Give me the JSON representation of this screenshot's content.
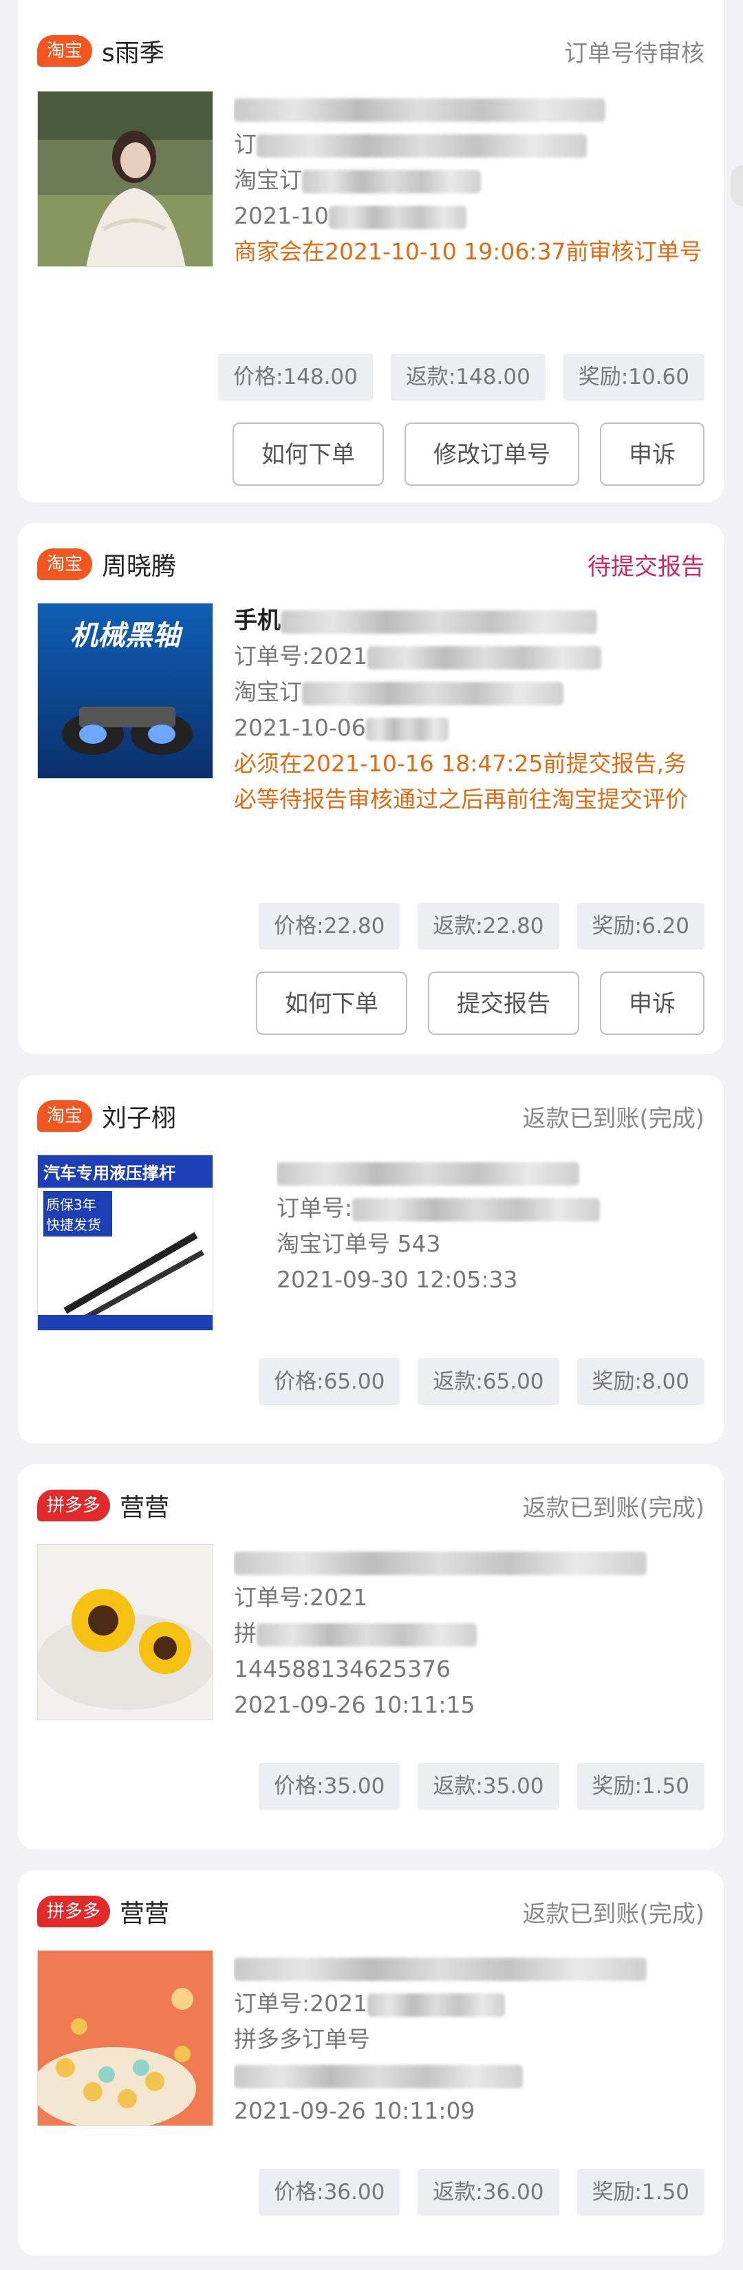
{
  "orders": [
    {
      "platform": "淘宝",
      "buyer": "s雨季",
      "status": "订单号待审核",
      "lines": [
        "订",
        "淘宝订",
        "2021-10"
      ],
      "warning": "商家会在2021-10-10 19:06:37前审核订单号",
      "price": "价格:148.00",
      "refund": "返款:148.00",
      "reward": "奖励:10.60",
      "actions": [
        "如何下单",
        "修改订单号",
        "申诉"
      ]
    },
    {
      "platform": "淘宝",
      "buyer": "周晓腾",
      "status": "待提交报告",
      "title": "手机",
      "lines": [
        "订单号:2021",
        "淘宝订",
        "2021-10-06"
      ],
      "warning": "必须在2021-10-16 18:47:25前提交报告,务必等待报告审核通过之后再前往淘宝提交评价",
      "price": "价格:22.80",
      "refund": "返款:22.80",
      "reward": "奖励:6.20",
      "actions": [
        "如何下单",
        "提交报告",
        "申诉"
      ],
      "thumb_text": "机械黑轴"
    },
    {
      "platform": "淘宝",
      "buyer": "刘子栩",
      "status": "返款已到账(完成)",
      "lines": [
        "订单号:",
        "淘宝订单号 543",
        "2021-09-30 12:05:33"
      ],
      "price": "价格:65.00",
      "refund": "返款:65.00",
      "reward": "奖励:8.00",
      "thumb_title": "汽车专用液压撑杆",
      "thumb_badge": "质保3年 快捷发货"
    },
    {
      "platform": "拼多多",
      "buyer": "营营",
      "status": "返款已到账(完成)",
      "lines": [
        "订单号:2021",
        "拼",
        "144588134625376",
        "2021-09-26 10:11:15"
      ],
      "price": "价格:35.00",
      "refund": "返款:35.00",
      "reward": "奖励:1.50"
    },
    {
      "platform": "拼多多",
      "buyer": "营营",
      "status": "返款已到账(完成)",
      "lines": [
        "订单号:2021",
        "拼多多订单号",
        "2021-09-26 10:11:09"
      ],
      "price": "价格:36.00",
      "refund": "返款:36.00",
      "reward": "奖励:1.50"
    }
  ],
  "colors": {
    "taobao_tag": "#f3561f",
    "pdd_tag": "#e12a2a",
    "warning_text": "#e06b12",
    "pending_status": "#d02763"
  }
}
